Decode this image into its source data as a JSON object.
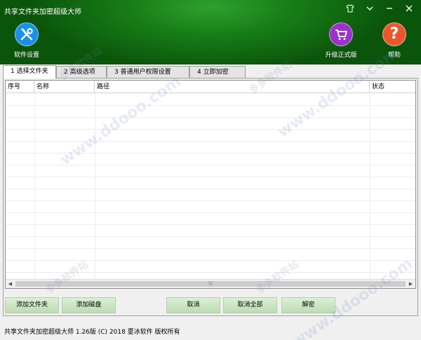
{
  "window": {
    "title": "共享文件夹加密超级大师",
    "controls": [
      "skin-icon",
      "menu-icon",
      "minimize-icon",
      "close-icon"
    ]
  },
  "toolbar": {
    "settings_label": "软件设置",
    "upgrade_label": "升级正式版",
    "help_label": "帮助"
  },
  "tabs": [
    {
      "label": "1 选择文件夹"
    },
    {
      "label": "2 高级选项"
    },
    {
      "label": "3 普通用户权限设置"
    },
    {
      "label": "4 立即加密"
    }
  ],
  "table": {
    "columns": [
      "序号",
      "名称",
      "路径",
      "状态"
    ]
  },
  "buttons": {
    "add_folder": "添加文件夹",
    "add_disk": "添加磁盘",
    "cancel": "取消",
    "cancel_all": "取消全部",
    "decrypt": "解密"
  },
  "status_bar": {
    "text": "共享文件夹加密超级大师  1.26版  (C) 2018 夏冰软件 版权所有"
  },
  "watermark": {
    "url": "www.ddooo.com",
    "cn": "多多软件站"
  },
  "colors": {
    "header_green": "#177d17",
    "settings_blue": "#1a8fe6",
    "upgrade_purple": "#9b33c7",
    "help_orange": "#e9582d",
    "button_green": "#c8e6c0"
  }
}
